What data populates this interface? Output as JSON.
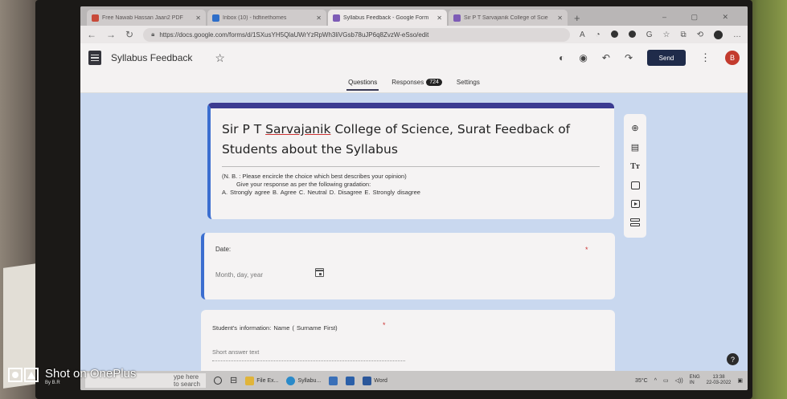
{
  "browser": {
    "tabs": [
      {
        "title": "Free Nawab Hassan Jaan2 PDF",
        "icon": "pdf-icon",
        "active": false
      },
      {
        "title": "Inbox (10) - fidfinethomes",
        "icon": "mail-icon",
        "active": false
      },
      {
        "title": "Syllabus Feedback - Google Form",
        "icon": "forms-icon",
        "active": true
      },
      {
        "title": "Sir P T Sarvajanik College of Scie",
        "icon": "page-icon",
        "active": false
      }
    ],
    "url": "https://docs.google.com/forms/d/1SXusYH5QlaUWrYzRpWh3liVGsb78uJP6q8ZvzW-eSso/edit",
    "new_tab": "+",
    "window_controls": "– ▢ ✕"
  },
  "forms_header": {
    "doc_title": "Syllabus Feedback",
    "send_label": "Send",
    "avatar_letter": "B"
  },
  "subtabs": {
    "questions": "Questions",
    "responses": "Responses",
    "responses_count": "724",
    "settings": "Settings"
  },
  "form": {
    "title_part1": "Sir P T ",
    "title_underlined": "Sarvajanik",
    "title_part2": " College of Science, Surat Feedback of Students about the Syllabus",
    "desc_line1": "(N. B. : Please encircle the choice which best describes your opinion)",
    "desc_line2": "Give your response as per the following gradation:",
    "desc_line3": "A. Strongly agree   B. Agree   C. Neutral   D. Disagree   E. Strongly disagree"
  },
  "questions": [
    {
      "label": "Date:",
      "placeholder": "Month, day, year",
      "required_mark": "*"
    },
    {
      "label": "Student's information: Name  ( Surname First)",
      "placeholder": "Short answer text",
      "required_mark": "*"
    }
  ],
  "help_label": "?",
  "taskbar": {
    "search_text": "ype here to search",
    "apps": [
      "File Ex...",
      "Syllabu...",
      "Word"
    ],
    "temperature": "35°C",
    "lang1": "ENG",
    "lang2": "IN",
    "time": "13:38",
    "date": "22-03-2022"
  },
  "watermark": {
    "main": "Shot on OnePlus",
    "sub": "By B.R"
  },
  "colors": {
    "accent": "#3b3b91",
    "background": "#c9d8ef",
    "send_button": "#1f2b4a",
    "avatar": "#c33b2e"
  }
}
